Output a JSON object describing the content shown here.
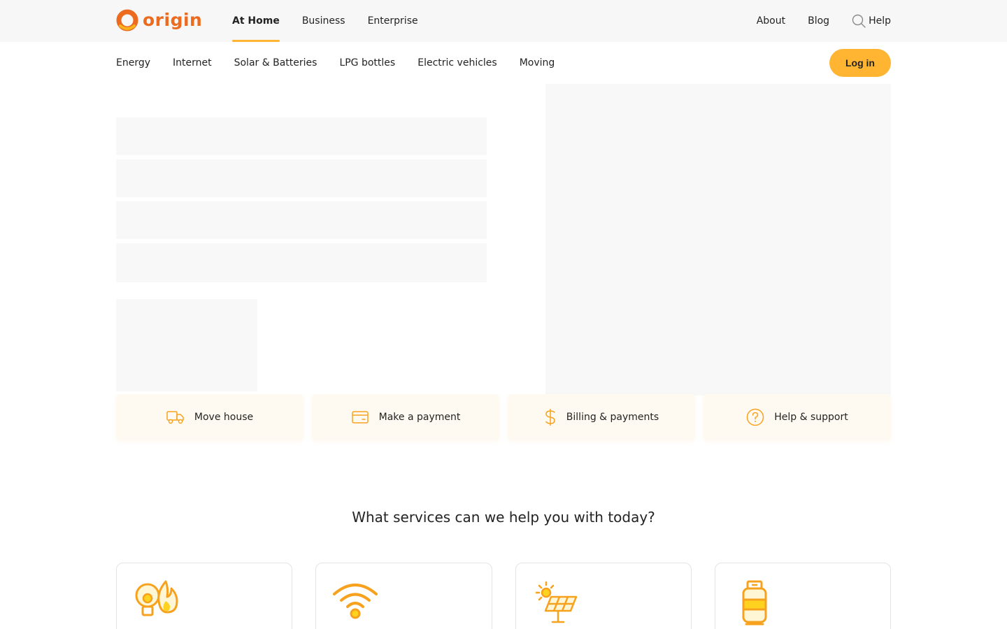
{
  "brand": {
    "name": "origin",
    "accent": "#ffb432",
    "logo_color": "#ec6b1f"
  },
  "top_nav": {
    "tabs": [
      {
        "label": "At Home",
        "active": true
      },
      {
        "label": "Business",
        "active": false
      },
      {
        "label": "Enterprise",
        "active": false
      }
    ],
    "links": {
      "about": "About",
      "blog": "Blog",
      "help": "Help"
    }
  },
  "sub_nav": {
    "items": [
      "Energy",
      "Internet",
      "Solar & Batteries",
      "LPG bottles",
      "Electric vehicles",
      "Moving"
    ],
    "login_label": "Log in"
  },
  "quick_actions": [
    {
      "label": "Move house",
      "icon": "truck-icon"
    },
    {
      "label": "Make a payment",
      "icon": "card-icon"
    },
    {
      "label": "Billing & payments",
      "icon": "dollar-icon"
    },
    {
      "label": "Help & support",
      "icon": "question-icon"
    }
  ],
  "services": {
    "title": "What services can we help you with today?",
    "cards": [
      {
        "icon": "bulb-flame-icon"
      },
      {
        "icon": "wifi-icon"
      },
      {
        "icon": "solar-panel-icon"
      },
      {
        "icon": "gas-bottle-icon"
      }
    ]
  }
}
